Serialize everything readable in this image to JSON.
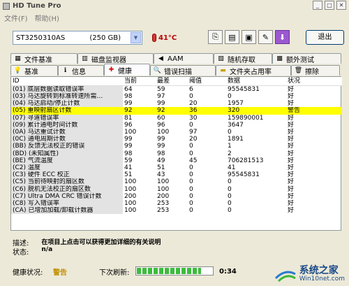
{
  "window": {
    "title": "HD Tune Pro"
  },
  "menu": [
    "文件(F)",
    "帮助(H)"
  ],
  "toolbar": {
    "drive_name": "ST3250310AS",
    "drive_size": "(250 GB)",
    "temperature": "41°C",
    "exit_label": "退出"
  },
  "tabs_row1": [
    {
      "label": "文件基准",
      "icon": "file-icon"
    },
    {
      "label": "磁盘监视器",
      "icon": "monitor-icon"
    },
    {
      "label": "AAM",
      "icon": "speaker-icon"
    },
    {
      "label": "随机存取",
      "icon": "random-icon"
    },
    {
      "label": "额外测试",
      "icon": "extra-icon"
    }
  ],
  "tabs_row2": [
    {
      "label": "基准",
      "icon": "bulb-icon"
    },
    {
      "label": "信息",
      "icon": "info-icon"
    },
    {
      "label": "健康",
      "icon": "health-cross-icon",
      "active": true
    },
    {
      "label": "错误扫描",
      "icon": "scan-icon"
    },
    {
      "label": "文件夹占用率",
      "icon": "folder-icon"
    },
    {
      "label": "擦除",
      "icon": "trash-icon"
    }
  ],
  "table": {
    "headers": [
      "ID",
      "当前",
      "最差",
      "阈值",
      "数据",
      "状况"
    ],
    "rows": [
      [
        "(01) 底层数据读取错误率",
        "64",
        "59",
        "6",
        "95545831",
        "好"
      ],
      [
        "(03) 马达旋转到标准转速所需…",
        "98",
        "97",
        "0",
        "0",
        "好"
      ],
      [
        "(04) 马达启动/停止计数",
        "99",
        "99",
        "20",
        "1957",
        "好"
      ],
      [
        "(05) 重映射扇区计数",
        "92",
        "92",
        "36",
        "320",
        "警告"
      ],
      [
        "(07) 寻道错误率",
        "81",
        "60",
        "30",
        "159890001",
        "好"
      ],
      [
        "(09) 累计通电时间计数",
        "96",
        "96",
        "0",
        "3647",
        "好"
      ],
      [
        "(0A) 马达重试计数",
        "100",
        "100",
        "97",
        "0",
        "好"
      ],
      [
        "(0C) 通电周期计数",
        "99",
        "99",
        "20",
        "1891",
        "好"
      ],
      [
        "(BB) 反馈无法校正的错误",
        "99",
        "99",
        "0",
        "1",
        "好"
      ],
      [
        "(BD) (未知属性)",
        "98",
        "98",
        "0",
        "2",
        "好"
      ],
      [
        "(BE) 气流温度",
        "59",
        "49",
        "45",
        "706281513",
        "好"
      ],
      [
        "(C2) 温度",
        "41",
        "51",
        "0",
        "41",
        "好"
      ],
      [
        "(C3) 硬件 ECC 校正",
        "51",
        "43",
        "0",
        "95545831",
        "好"
      ],
      [
        "(C5) 当前待映射的扇区数",
        "100",
        "100",
        "0",
        "0",
        "好"
      ],
      [
        "(C6) 脱机无法校正的扇区数",
        "100",
        "100",
        "0",
        "0",
        "好"
      ],
      [
        "(C7) Ultra DMA CRC 错误计数",
        "200",
        "200",
        "0",
        "0",
        "好"
      ],
      [
        "(C8) 写入错误率",
        "100",
        "253",
        "0",
        "0",
        "好"
      ],
      [
        "(CA) 已增加加载/卸载计数器",
        "100",
        "253",
        "0",
        "0",
        "好"
      ]
    ],
    "warning_row_index": 3
  },
  "description": {
    "desc_label": "描述:",
    "desc_value": "在项目上点击可以获得更加详细的有关说明",
    "status_label": "状态:",
    "status_value": "n/a"
  },
  "status": {
    "health_label": "健康状况:",
    "health_value": "警告",
    "refresh_label": "下次刷新:",
    "refresh_progress": 0.85,
    "timer": "0:34"
  },
  "watermark": {
    "main": "系统之家",
    "sub": "Win10net.com"
  },
  "colors": {
    "warning_row": "#FFFF00",
    "health_warning": "#C09000"
  }
}
